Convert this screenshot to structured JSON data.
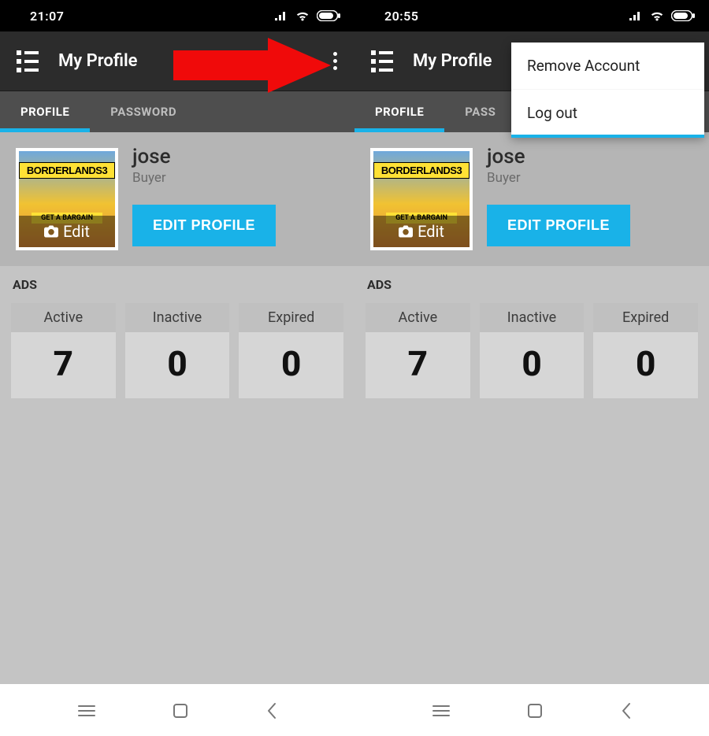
{
  "colors": {
    "accent": "#19b2e8",
    "arrow": "#f00a0a"
  },
  "left": {
    "status": {
      "time": "21:07"
    },
    "appbar": {
      "title": "My Profile"
    },
    "tabs": {
      "profile": "PROFILE",
      "password": "PASSWORD"
    },
    "profile": {
      "name": "jose",
      "role": "Buyer",
      "avatar_band_top": "BORDERLANDS3",
      "avatar_band_mid": "GET A BARGAIN",
      "avatar_overlay": "Edit",
      "edit_button": "EDIT PROFILE"
    },
    "ads": {
      "title": "ADS",
      "cards": [
        {
          "label": "Active",
          "value": "7"
        },
        {
          "label": "Inactive",
          "value": "0"
        },
        {
          "label": "Expired",
          "value": "0"
        }
      ]
    }
  },
  "right": {
    "status": {
      "time": "20:55"
    },
    "appbar": {
      "title": "My Profile"
    },
    "tabs": {
      "profile": "PROFILE",
      "password": "PASS"
    },
    "menu": {
      "remove": "Remove Account",
      "logout": "Log out"
    },
    "profile": {
      "name": "jose",
      "role": "Buyer",
      "avatar_band_top": "BORDERLANDS3",
      "avatar_band_mid": "GET A BARGAIN",
      "avatar_overlay": "Edit",
      "edit_button": "EDIT PROFILE"
    },
    "ads": {
      "title": "ADS",
      "cards": [
        {
          "label": "Active",
          "value": "7"
        },
        {
          "label": "Inactive",
          "value": "0"
        },
        {
          "label": "Expired",
          "value": "0"
        }
      ]
    }
  }
}
